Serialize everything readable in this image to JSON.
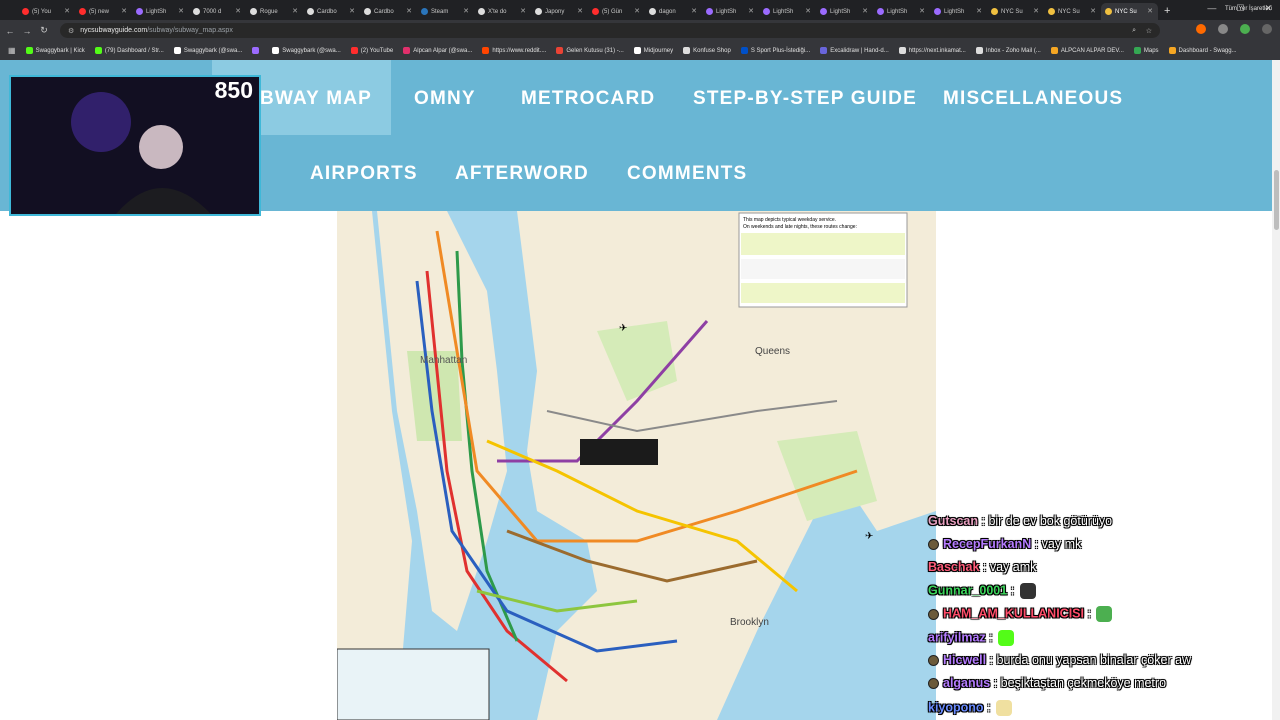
{
  "browser": {
    "tabs": [
      {
        "label": "(5) You",
        "color": "#ff2d2d"
      },
      {
        "label": "(5) new",
        "color": "#ff2d2d"
      },
      {
        "label": "LightSh",
        "color": "#9b6bff"
      },
      {
        "label": "7000 d",
        "color": "#dddddd"
      },
      {
        "label": "Rogue",
        "color": "#dddddd"
      },
      {
        "label": "Cardbo",
        "color": "#dddddd"
      },
      {
        "label": "Cardbo",
        "color": "#dddddd"
      },
      {
        "label": "Steam",
        "color": "#2a75bb"
      },
      {
        "label": "X'te do",
        "color": "#dddddd"
      },
      {
        "label": "Japony",
        "color": "#dddddd"
      },
      {
        "label": "(5) Gün",
        "color": "#ff2d2d"
      },
      {
        "label": "dagon",
        "color": "#dddddd"
      },
      {
        "label": "LightSh",
        "color": "#9b6bff"
      },
      {
        "label": "LightSh",
        "color": "#9b6bff"
      },
      {
        "label": "LightSh",
        "color": "#9b6bff"
      },
      {
        "label": "LightSh",
        "color": "#9b6bff"
      },
      {
        "label": "LightSh",
        "color": "#9b6bff"
      },
      {
        "label": "NYC Su",
        "color": "#f0c040"
      },
      {
        "label": "NYC Su",
        "color": "#f0c040"
      },
      {
        "label": "NYC Su",
        "color": "#f0c040",
        "active": true
      }
    ],
    "address": {
      "domain": "nycsubwayguide.com",
      "path": "/subway/subway_map.aspx"
    },
    "bookmarks": [
      {
        "label": "Swaggybark | Kick",
        "color": "#53fc18"
      },
      {
        "label": "(79) Dashboard / Str...",
        "color": "#53fc18"
      },
      {
        "label": "Swaggybark (@swa...",
        "color": "#ffffff"
      },
      {
        "label": "",
        "color": "#9b6bff"
      },
      {
        "label": "Swaggybark (@swa...",
        "color": "#ffffff"
      },
      {
        "label": "(2) YouTube",
        "color": "#ff2d2d"
      },
      {
        "label": "Alpcan Alpar (@swa...",
        "color": "#e1306c"
      },
      {
        "label": "https://www.reddit....",
        "color": "#ff4500"
      },
      {
        "label": "Gelen Kutusu (31) -...",
        "color": "#ea4335"
      },
      {
        "label": "Midjourney",
        "color": "#ffffff"
      },
      {
        "label": "Konfuse Shop",
        "color": "#dddddd"
      },
      {
        "label": "S Sport Plus-İstediği...",
        "color": "#0050c8"
      },
      {
        "label": "Excalidraw | Hand-d...",
        "color": "#6965db"
      },
      {
        "label": "https://next.inkamat...",
        "color": "#dddddd"
      },
      {
        "label": "Inbox - Zoho Mail (...",
        "color": "#dddddd"
      },
      {
        "label": "ALPCAN ALPAR DEV...",
        "color": "#f5a623"
      },
      {
        "label": "Maps",
        "color": "#34a853"
      },
      {
        "label": "Dashboard - Swagg...",
        "color": "#f5a623"
      }
    ],
    "all_bookmarks": "Tüm Yer İşaretleri"
  },
  "site_nav": {
    "row1": [
      "BWAY MAP",
      "OMNY",
      "METROCARD",
      "STEP-BY-STEP GUIDE",
      "MISCELLANEOUS"
    ],
    "row2": [
      "AIRPORTS",
      "AFTERWORD",
      "COMMENTS"
    ],
    "bg": "#69b6d4",
    "active_bg": "#8ccbe2"
  },
  "map": {
    "labels": {
      "manhattan": "Manhattan",
      "queens": "Queens",
      "brooklyn": "Brooklyn"
    },
    "legend_title": "This map depicts typical weekday service.",
    "legend_subtitle": "On weekends and late nights, these routes change:"
  },
  "stream": {
    "viewers": "850",
    "chat": [
      {
        "user": "Gutscan",
        "color": "#e8a0c0",
        "text": "bir de ev bok götürüyo",
        "badge": false
      },
      {
        "user": "RecepFurkanN",
        "color": "#b57cff",
        "text": "vay mk",
        "badge": true
      },
      {
        "user": "Baschak",
        "color": "#ff5c7a",
        "text": "vay amk",
        "badge": false
      },
      {
        "user": "Gunnar_0001",
        "color": "#3cd65c",
        "text": "",
        "badge": false,
        "emote": "#333333"
      },
      {
        "user": "HAM_AM_KULLANICISI",
        "color": "#ff4d6a",
        "text": "",
        "badge": true,
        "emote": "#4caf50"
      },
      {
        "user": "arifyilmaz",
        "color": "#b57cff",
        "text": "",
        "badge": false,
        "emote": "#53fc18"
      },
      {
        "user": "Hicwell",
        "color": "#b57cff",
        "text": "burda onu yapsan binalar çöker aw",
        "badge": true
      },
      {
        "user": "alganus",
        "color": "#b57cff",
        "text": "beşiktaştan çekmeköye metro",
        "badge": true
      },
      {
        "user": "kiyopono",
        "color": "#6a8cff",
        "text": "",
        "badge": false,
        "emote": "#f0e0a0"
      }
    ]
  }
}
